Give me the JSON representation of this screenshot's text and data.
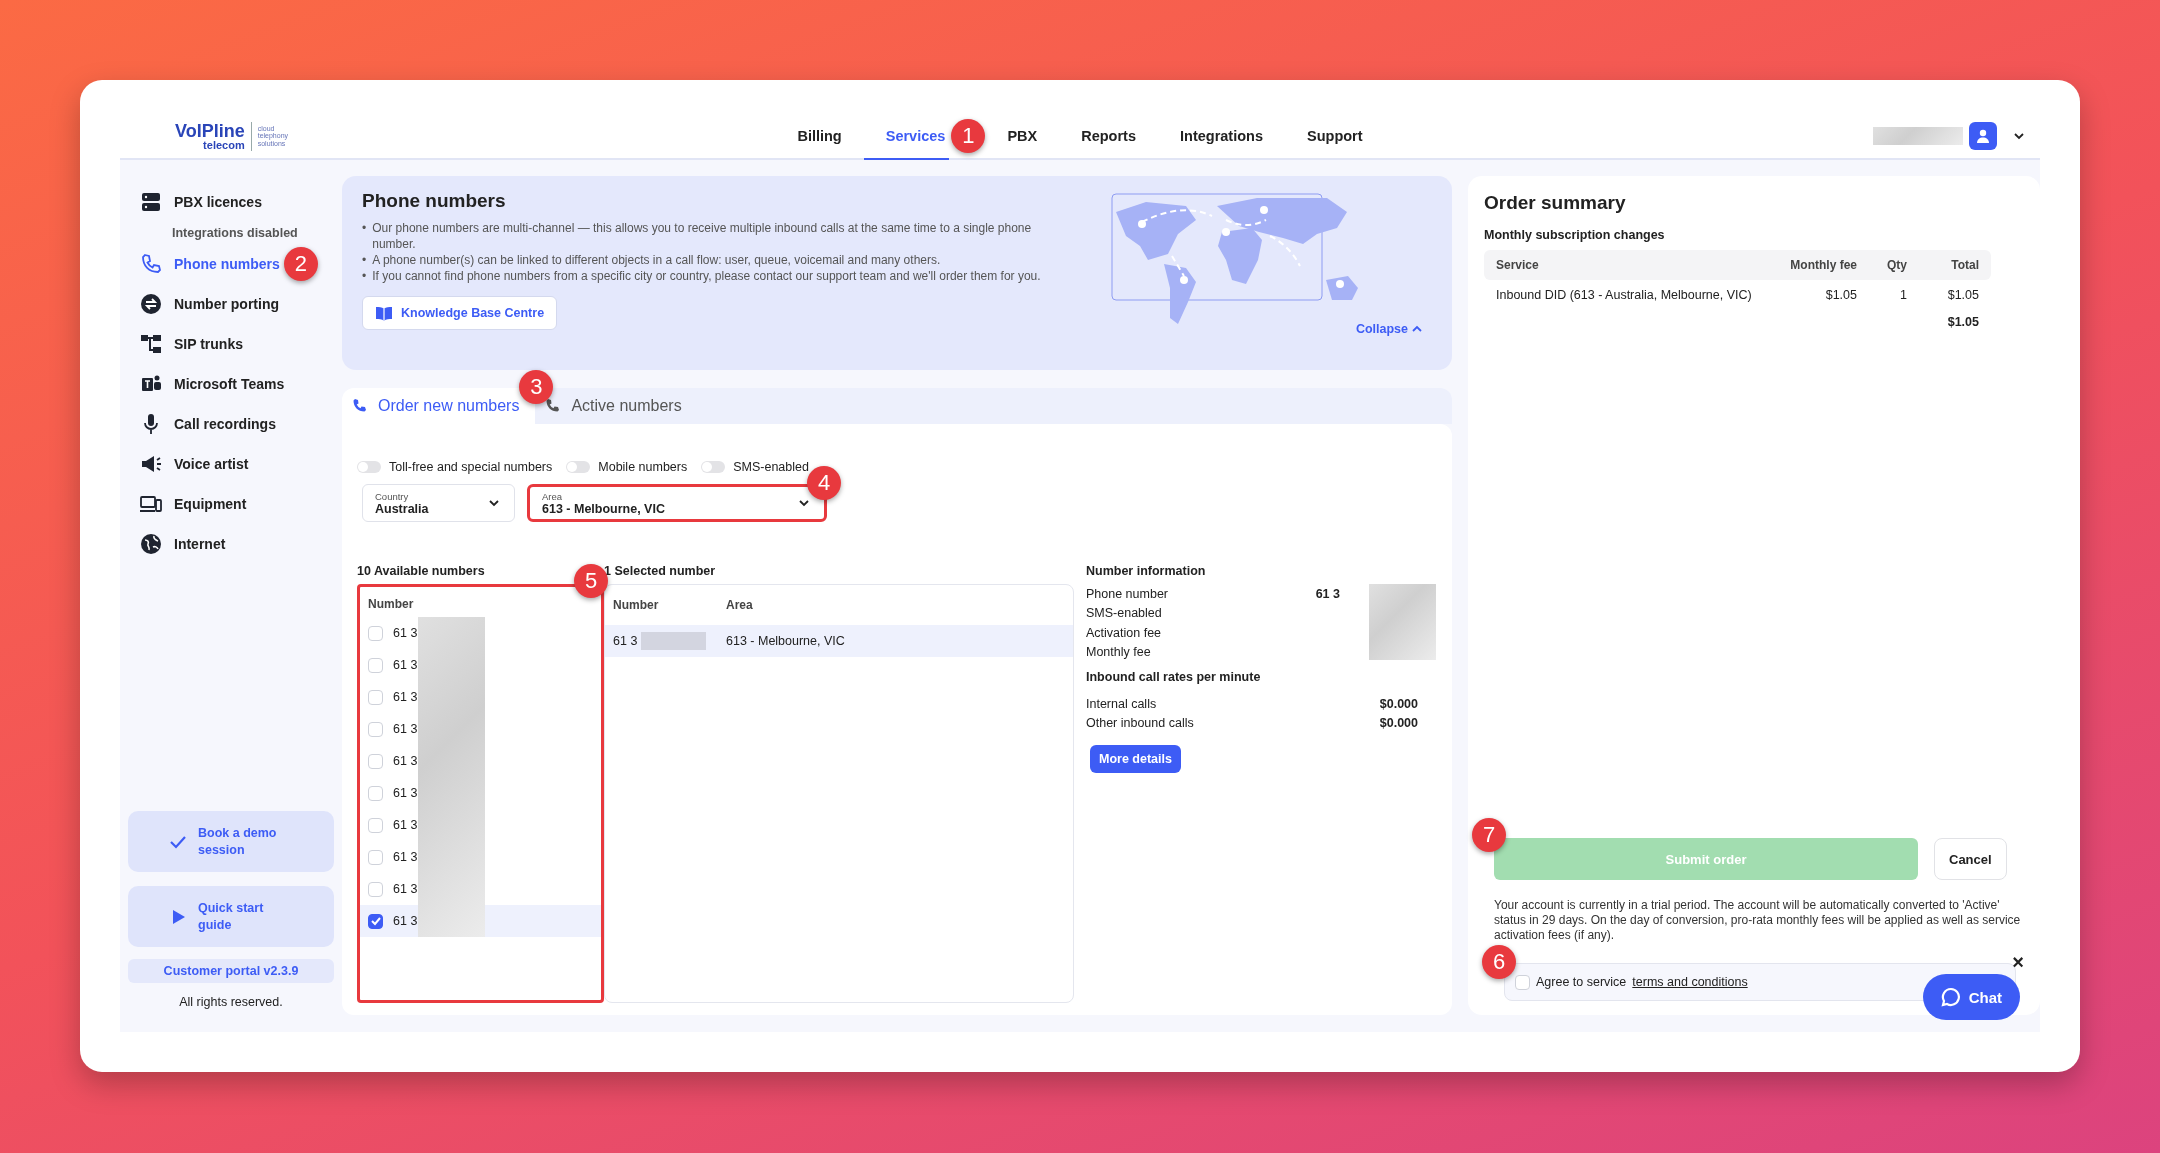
{
  "header": {
    "logo": {
      "name": "VoIPline",
      "sub": "telecom",
      "tagline": "cloud telephony solutions"
    },
    "nav": [
      {
        "label": "Billing",
        "selected": false
      },
      {
        "label": "Services",
        "selected": true,
        "badge": "1"
      },
      {
        "label": "PBX",
        "selected": false
      },
      {
        "label": "Reports",
        "selected": false
      },
      {
        "label": "Integrations",
        "selected": false
      },
      {
        "label": "Support",
        "selected": false
      }
    ]
  },
  "sidebar": {
    "items": [
      {
        "label": "PBX licences",
        "selected": false,
        "note": "Integrations disabled"
      },
      {
        "label": "Phone numbers",
        "selected": true,
        "badge": "2"
      },
      {
        "label": "Number porting",
        "selected": false
      },
      {
        "label": "SIP trunks",
        "selected": false
      },
      {
        "label": "Microsoft Teams",
        "selected": false
      },
      {
        "label": "Call recordings",
        "selected": false
      },
      {
        "label": "Voice artist",
        "selected": false
      },
      {
        "label": "Equipment",
        "selected": false
      },
      {
        "label": "Internet",
        "selected": false
      }
    ],
    "promos": [
      {
        "label": "Book a demo session"
      },
      {
        "label": "Quick start guide"
      }
    ],
    "version": "Customer portal v2.3.9",
    "footer": "All rights reserved."
  },
  "info_panel": {
    "title": "Phone numbers",
    "marker": "•",
    "bullets": [
      "Our phone numbers are multi-channel — this allows you to receive multiple inbound calls at the same time to a single phone number.",
      "A phone number(s) can be linked to different objects in a call flow: user, queue, voicemail and many others.",
      "If you cannot find phone numbers from a specific city or country, please contact our support team and we'll order them for you."
    ],
    "button": "Knowledge Base Centre",
    "collapse": "Collapse"
  },
  "tabs": [
    {
      "label": "Order new numbers",
      "selected": true,
      "badge": "3"
    },
    {
      "label": "Active numbers",
      "selected": false
    }
  ],
  "filters": [
    {
      "label": "Toll-free and special numbers",
      "on": false
    },
    {
      "label": "Mobile numbers",
      "on": false
    },
    {
      "label": "SMS-enabled",
      "on": false
    }
  ],
  "selects": [
    {
      "label": "Country",
      "value": "Australia",
      "highlighted": false
    },
    {
      "label": "Area",
      "value": "613 - Melbourne, VIC",
      "highlighted": true,
      "badge": "4"
    }
  ],
  "available": {
    "title": "10 Available numbers",
    "column": "Number",
    "highlighted": true,
    "badge": "5",
    "rows": [
      {
        "number": "61 3",
        "checked": false
      },
      {
        "number": "61 3",
        "checked": false
      },
      {
        "number": "61 3",
        "checked": false
      },
      {
        "number": "61 3",
        "checked": false
      },
      {
        "number": "61 3",
        "checked": false
      },
      {
        "number": "61 3",
        "checked": false
      },
      {
        "number": "61 3",
        "checked": false
      },
      {
        "number": "61 3",
        "checked": false
      },
      {
        "number": "61 3",
        "checked": false
      },
      {
        "number": "61 3",
        "checked": true
      }
    ]
  },
  "selected_numbers": {
    "title": "1 Selected number",
    "columns": [
      "Number",
      "Area"
    ],
    "rows": [
      {
        "number": "61 3",
        "area": "613 - Melbourne, VIC"
      }
    ]
  },
  "number_info": {
    "title": "Number information",
    "rows": [
      {
        "label": "Phone number",
        "value": "61 3"
      },
      {
        "label": "SMS-enabled"
      },
      {
        "label": "Activation fee"
      },
      {
        "label": "Monthly fee"
      }
    ],
    "rates_title": "Inbound call rates per minute",
    "rates": [
      {
        "label": "Internal calls",
        "value": "$0.000"
      },
      {
        "label": "Other inbound calls",
        "value": "$0.000"
      }
    ],
    "button": "More details"
  },
  "order_summary": {
    "title": "Order summary",
    "subtitle": "Monthly subscription changes",
    "columns": [
      "Service",
      "Monthly fee",
      "Qty",
      "Total"
    ],
    "rows": [
      {
        "service": "Inbound DID (613 - Australia, Melbourne, VIC)",
        "fee": "$1.05",
        "qty": "1",
        "total": "$1.05"
      }
    ],
    "grand_total": "$1.05",
    "submit": {
      "label": "Submit order",
      "disabled": true,
      "badge": "7"
    },
    "cancel": "Cancel",
    "notice": "Your account is currently in a trial period. The account will be automatically converted to 'Active' status in 29 days. On the day of conversion, pro-rata monthly fees will be applied as well as service activation fees (if any).",
    "agree": {
      "text": "Agree to service",
      "link": "terms and conditions",
      "checked": false,
      "badge": "6"
    }
  },
  "chat": {
    "label": "Chat",
    "close": "×"
  }
}
